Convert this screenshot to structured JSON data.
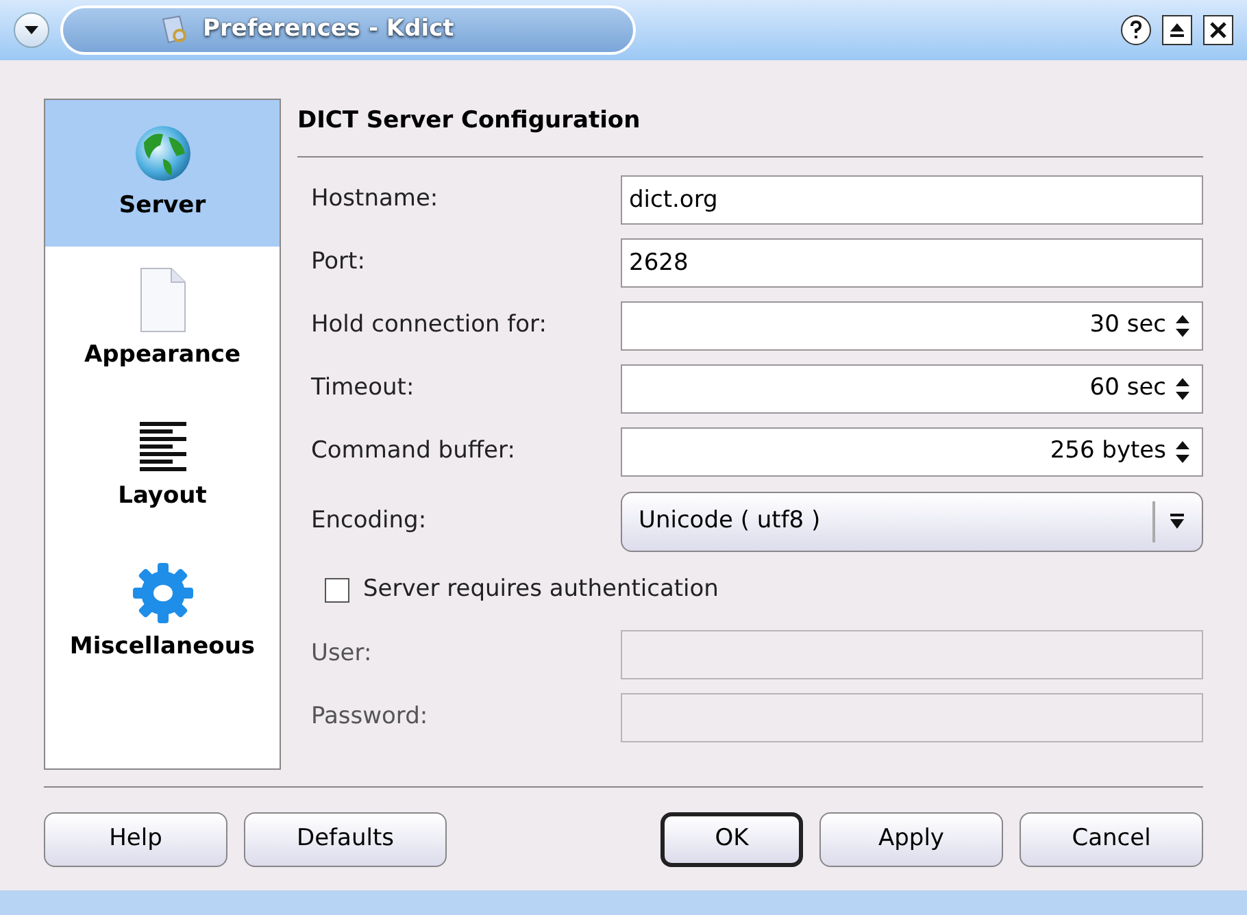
{
  "window": {
    "title": "Preferences - Kdict"
  },
  "sidebar": {
    "items": [
      {
        "label": "Server",
        "kind": "globe",
        "selected": true
      },
      {
        "label": "Appearance",
        "kind": "page",
        "selected": false
      },
      {
        "label": "Layout",
        "kind": "lines",
        "selected": false
      },
      {
        "label": "Miscellaneous",
        "kind": "gear",
        "selected": false
      }
    ]
  },
  "page": {
    "title": "DICT Server Configuration",
    "fields": [
      {
        "label": "Hostname:",
        "kind": "text",
        "value": "dict.org",
        "disabled": false
      },
      {
        "label": "Port:",
        "kind": "text",
        "value": "2628",
        "disabled": false
      },
      {
        "label": "Hold connection for:",
        "kind": "spin",
        "value": "30 sec"
      },
      {
        "label": "Timeout:",
        "kind": "spin",
        "value": "60 sec"
      },
      {
        "label": "Command buffer:",
        "kind": "spin",
        "value": "256 bytes"
      },
      {
        "label": "Encoding:",
        "kind": "select",
        "value": "Unicode ( utf8 )"
      },
      {
        "label": "Server requires authentication",
        "kind": "checkbox",
        "checked": false
      },
      {
        "label": "User:",
        "kind": "text",
        "disabled": true
      },
      {
        "label": "Password:",
        "kind": "text",
        "disabled": true
      }
    ]
  },
  "buttons": [
    {
      "label": "Help",
      "default": false
    },
    {
      "label": "Defaults",
      "default": false
    },
    {
      "label": "OK",
      "default": true
    },
    {
      "label": "Apply",
      "default": false
    },
    {
      "label": "Cancel",
      "default": false
    }
  ]
}
